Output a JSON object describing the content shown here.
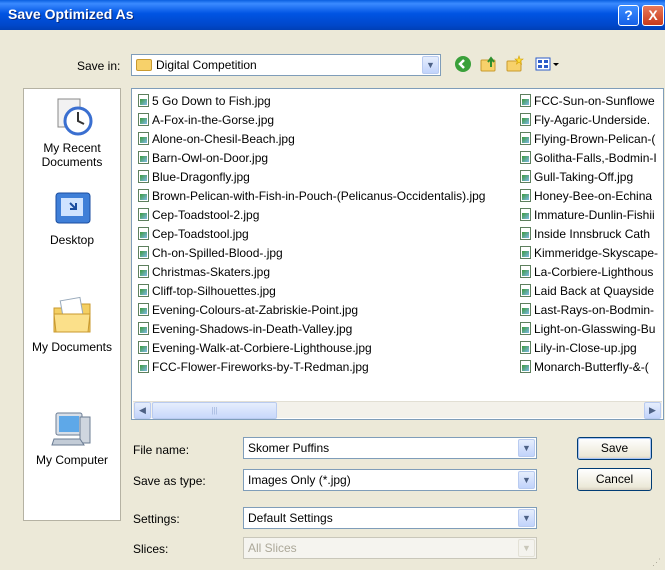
{
  "window": {
    "title": "Save Optimized As"
  },
  "titlebar_buttons": {
    "help": "?",
    "close": "X"
  },
  "toolbar": {
    "save_in_label": "Save in:",
    "save_in_value": "Digital Competition",
    "icons": [
      "back-arrow-icon",
      "up-folder-icon",
      "new-folder-icon",
      "views-menu-icon"
    ]
  },
  "places": [
    {
      "label": "My Recent Documents",
      "icon": "recent-documents-icon"
    },
    {
      "label": "Desktop",
      "icon": "desktop-icon"
    },
    {
      "label": "My Documents",
      "icon": "my-documents-icon"
    },
    {
      "label": "My Computer",
      "icon": "my-computer-icon"
    }
  ],
  "files_column1": [
    "5 Go Down to Fish.jpg",
    "A-Fox-in-the-Gorse.jpg",
    "Alone-on-Chesil-Beach.jpg",
    "Barn-Owl-on-Door.jpg",
    "Blue-Dragonfly.jpg",
    "Brown-Pelican-with-Fish-in-Pouch-(Pelicanus-Occidentalis).jpg",
    "Cep-Toadstool-2.jpg",
    "Cep-Toadstool.jpg",
    "Ch-on-Spilled-Blood-.jpg",
    "Christmas-Skaters.jpg",
    "Cliff-top-Silhouettes.jpg",
    "Evening-Colours-at-Zabriskie-Point.jpg",
    "Evening-Shadows-in-Death-Valley.jpg",
    "Evening-Walk-at-Corbiere-Lighthouse.jpg",
    "FCC-Flower-Fireworks-by-T-Redman.jpg"
  ],
  "files_column2": [
    "FCC-Sun-on-Sunflowe",
    "Fly-Agaric-Underside.",
    "Flying-Brown-Pelican-(",
    "Golitha-Falls,-Bodmin-I",
    "Gull-Taking-Off.jpg",
    "Honey-Bee-on-Echina",
    "Immature-Dunlin-Fishii",
    "Inside Innsbruck Cath",
    "Kimmeridge-Skyscape-",
    "La-Corbiere-Lighthous",
    "Laid Back at Quayside",
    "Last-Rays-on-Bodmin-",
    "Light-on-Glasswing-Bu",
    "Lily-in-Close-up.jpg",
    "Monarch-Butterfly-&-("
  ],
  "form": {
    "file_name_label": "File name:",
    "file_name_value": "Skomer Puffins",
    "save_as_type_label": "Save as type:",
    "save_as_type_value": "Images Only (*.jpg)",
    "settings_label": "Settings:",
    "settings_value": "Default Settings",
    "slices_label": "Slices:",
    "slices_value": "All Slices"
  },
  "buttons": {
    "save": "Save",
    "cancel": "Cancel"
  }
}
